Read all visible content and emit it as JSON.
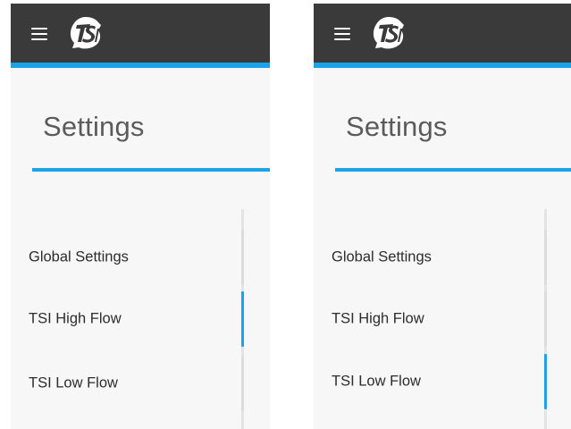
{
  "colors": {
    "header_bg": "#3a3a3a",
    "accent": "#1aa3e8",
    "panel_bg": "#f7f7f7",
    "title_text": "#5b5b5b",
    "item_text": "#2c2c2c",
    "inactive_indicator": "#dcdcdc"
  },
  "icons": {
    "menu": "hamburger-menu-icon",
    "logo": "tsi-logo"
  },
  "panels": [
    {
      "page_title": "Settings",
      "nav_items": [
        {
          "label": "Global Settings",
          "active": false
        },
        {
          "label": "TSI High Flow",
          "active": true
        },
        {
          "label": "TSI Low Flow",
          "active": false
        }
      ]
    },
    {
      "page_title": "Settings",
      "nav_items": [
        {
          "label": "Global Settings",
          "active": false
        },
        {
          "label": "TSI High Flow",
          "active": false
        },
        {
          "label": "TSI Low Flow",
          "active": true
        }
      ]
    }
  ],
  "logo_text": "TSI"
}
